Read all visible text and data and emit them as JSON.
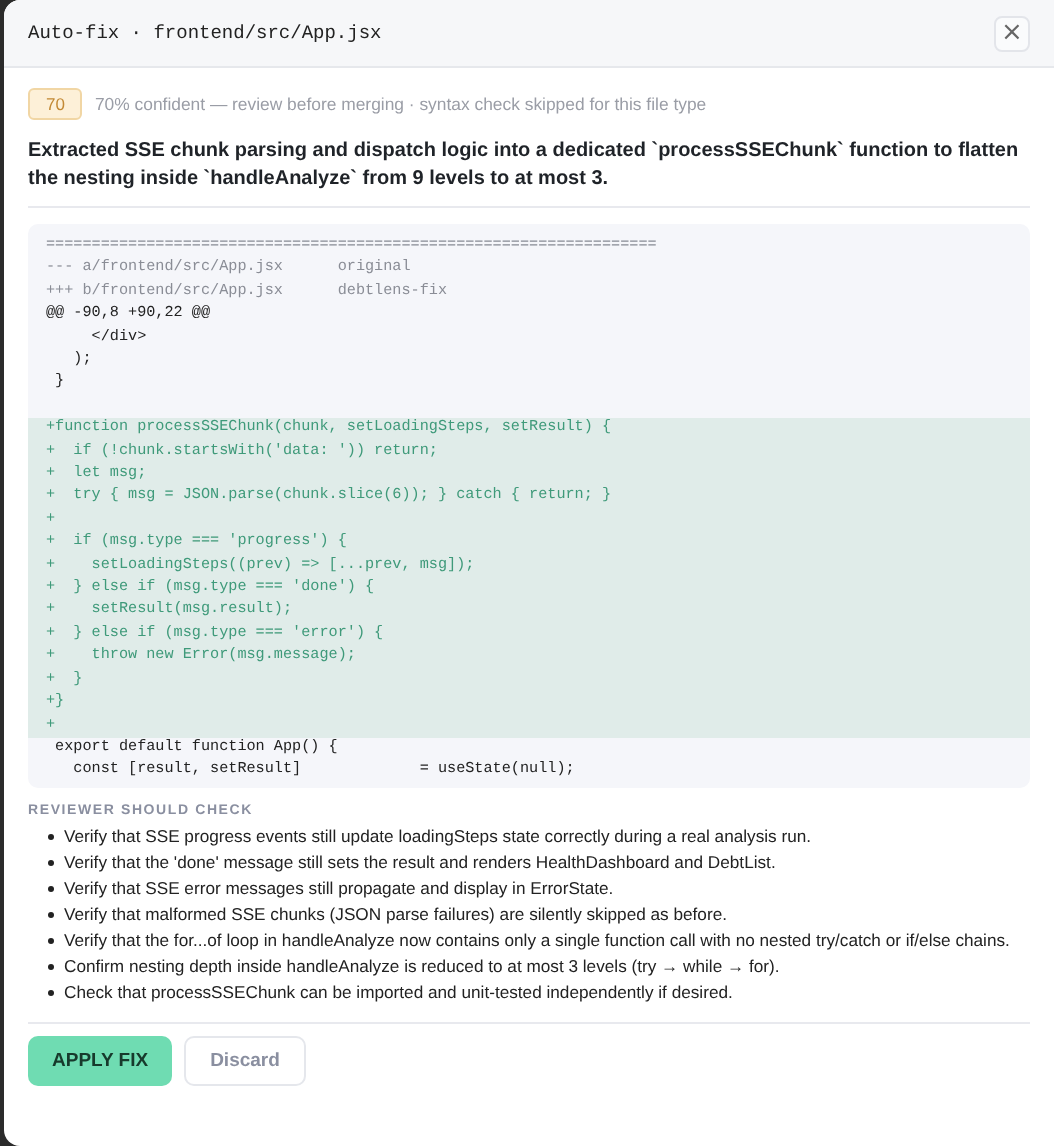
{
  "header": {
    "title": "Auto-fix · frontend/src/App.jsx",
    "close": "×"
  },
  "confidence": {
    "badge": "70",
    "note": "70% confident — review before merging · syntax check skipped for this file type"
  },
  "summary": "Extracted SSE chunk parsing and dispatch logic into a dedicated `processSSEChunk` function to flatten the nesting inside `handleAnalyze` from 9 levels to at most 3.",
  "diff": [
    {
      "kind": "meta",
      "text": "==================================================================="
    },
    {
      "kind": "meta",
      "text": "--- a/frontend/src/App.jsx      original"
    },
    {
      "kind": "meta",
      "text": "+++ b/frontend/src/App.jsx      debtlens-fix"
    },
    {
      "kind": "hunk",
      "text": "@@ -90,8 +90,22 @@"
    },
    {
      "kind": "context",
      "text": "     </div>"
    },
    {
      "kind": "context",
      "text": "   );"
    },
    {
      "kind": "context",
      "text": " }"
    },
    {
      "kind": "blank"
    },
    {
      "kind": "add",
      "text": "+function processSSEChunk(chunk, setLoadingSteps, setResult) {"
    },
    {
      "kind": "add",
      "text": "+  if (!chunk.startsWith('data: ')) return;"
    },
    {
      "kind": "add",
      "text": "+  let msg;"
    },
    {
      "kind": "add",
      "text": "+  try { msg = JSON.parse(chunk.slice(6)); } catch { return; }"
    },
    {
      "kind": "add",
      "text": "+"
    },
    {
      "kind": "add",
      "text": "+  if (msg.type === 'progress') {"
    },
    {
      "kind": "add",
      "text": "+    setLoadingSteps((prev) => [...prev, msg]);"
    },
    {
      "kind": "add",
      "text": "+  } else if (msg.type === 'done') {"
    },
    {
      "kind": "add",
      "text": "+    setResult(msg.result);"
    },
    {
      "kind": "add",
      "text": "+  } else if (msg.type === 'error') {"
    },
    {
      "kind": "add",
      "text": "+    throw new Error(msg.message);"
    },
    {
      "kind": "add",
      "text": "+  }"
    },
    {
      "kind": "add",
      "text": "+}"
    },
    {
      "kind": "add",
      "text": "+"
    },
    {
      "kind": "context",
      "text": " export default function App() {"
    },
    {
      "kind": "context",
      "text": "   const [result, setResult]             = useState(null);"
    }
  ],
  "checks": {
    "heading": "REVIEWER SHOULD CHECK",
    "items": [
      "Verify that SSE progress events still update loadingSteps state correctly during a real analysis run.",
      "Verify that the 'done' message still sets the result and renders HealthDashboard and DebtList.",
      "Verify that SSE error messages still propagate and display in ErrorState.",
      "Verify that malformed SSE chunks (JSON parse failures) are silently skipped as before.",
      "Verify that the for...of loop in handleAnalyze now contains only a single function call with no nested try/catch or if/else chains.",
      "Confirm nesting depth inside handleAnalyze is reduced to at most 3 levels (try → while → for).",
      "Check that processSSEChunk can be imported and unit-tested independently if desired."
    ]
  },
  "buttons": {
    "apply": "APPLY FIX",
    "discard": "Discard"
  }
}
